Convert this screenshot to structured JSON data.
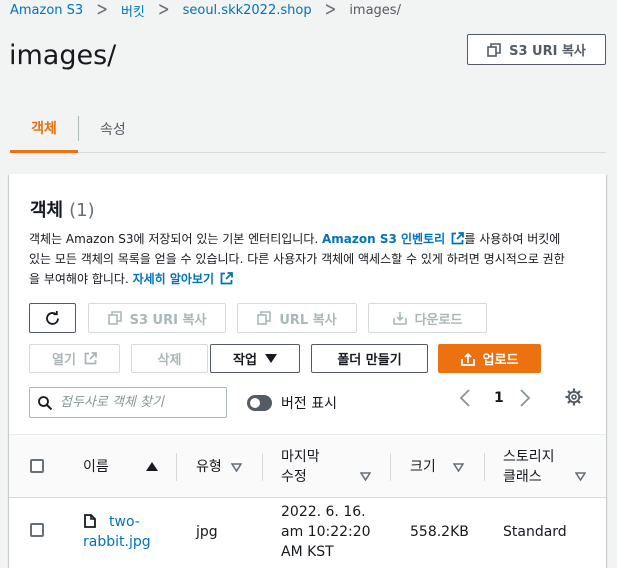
{
  "breadcrumb": {
    "items": [
      "Amazon S3",
      "버킷",
      "seoul.skk2022.shop"
    ],
    "current": "images/",
    "separator": ">"
  },
  "page": {
    "title": "images/",
    "copy_uri_label": "S3 URI 복사"
  },
  "tabs": [
    {
      "label": "객체",
      "active": true
    },
    {
      "label": "속성",
      "active": false
    }
  ],
  "objects_panel": {
    "title": "객체",
    "count": "(1)",
    "description_1": "객체는 Amazon S3에 저장되어 있는 기본 엔터티입니다. ",
    "inventory_link": "Amazon S3 인벤토리",
    "description_2": "를 사용하여 버킷에 있는 모든 객체의 목록을 얻을 수 있습니다. 다른 사용자가 객체에 액세스할 수 있게 하려면 명시적으로 권한을 부여해야 합니다. ",
    "learn_more_link": "자세히 알아보기"
  },
  "toolbar": {
    "copy_s3_uri": "S3 URI 복사",
    "copy_url": "URL 복사",
    "download": "다운로드",
    "open": "열기",
    "delete": "삭제",
    "actions": "작업",
    "create_folder": "폴더 만들기",
    "upload": "업로드"
  },
  "search": {
    "placeholder": "접두사로 객체 찾기",
    "value": ""
  },
  "version_toggle": {
    "label": "버전 표시",
    "on": false
  },
  "pagination": {
    "page": "1"
  },
  "table": {
    "columns": {
      "name": "이름",
      "type": "유형",
      "last_modified_1": "마지막",
      "last_modified_2": "수정",
      "size": "크기",
      "storage_class_1": "스토리지",
      "storage_class_2": "클래스"
    },
    "rows": [
      {
        "name_1": "two-",
        "name_2": "rabbit.jpg",
        "type": "jpg",
        "modified_1": "2022. 6. 16.",
        "modified_2": "am 10:22:20",
        "modified_3": "AM KST",
        "size": "558.2KB",
        "storage_class": "Standard"
      }
    ]
  },
  "colors": {
    "link": "#0073bb",
    "primary": "#ec7211",
    "text": "#16191f",
    "muted": "#687078",
    "disabled": "#aab7b8"
  },
  "icons": [
    "chevron-right-icon",
    "copy-icon",
    "refresh-icon",
    "download-icon",
    "external-link-icon",
    "caret-down-icon",
    "upload-icon",
    "search-icon",
    "chevron-left-icon",
    "gear-icon",
    "sort-up-icon",
    "sort-down-icon",
    "file-icon"
  ]
}
